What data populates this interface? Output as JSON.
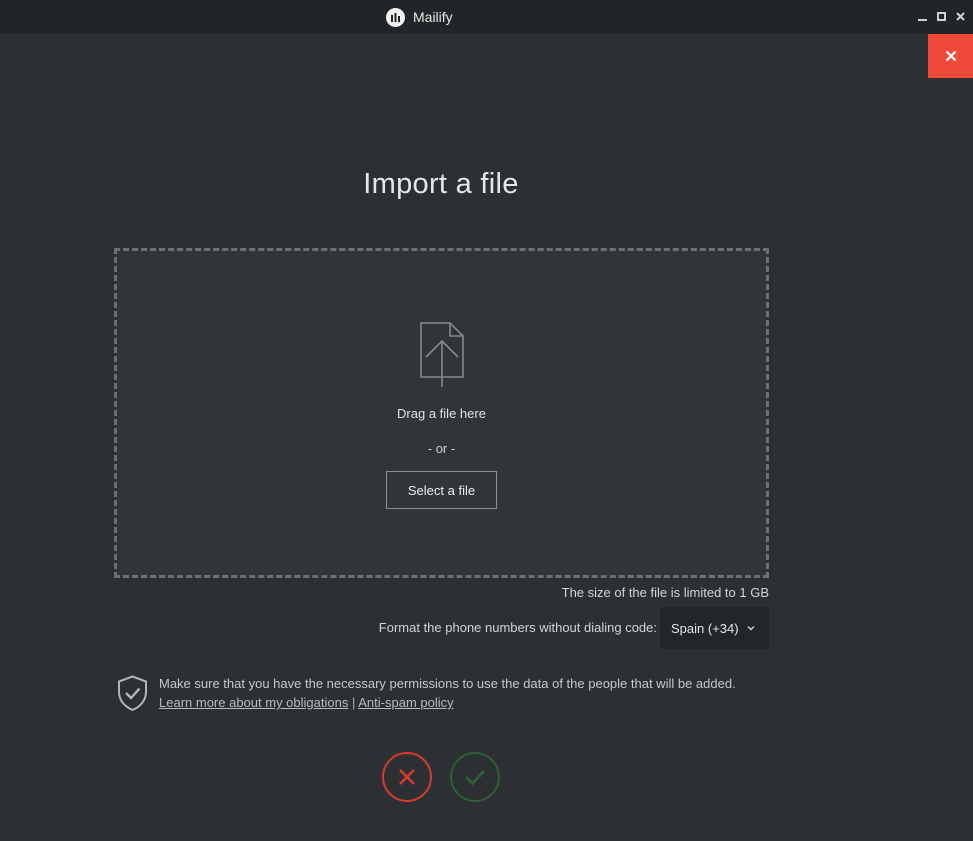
{
  "window": {
    "title": "Mailify",
    "close_color": "#f04a3a"
  },
  "main": {
    "title": "Import a file",
    "dropzone": {
      "icon": "file-upload-icon",
      "drag_text": "Drag a file here",
      "or_text": "- or -",
      "select_button": "Select a file"
    },
    "size_note": "The size of the file is limited to 1 GB",
    "phone_format": {
      "label": "Format the phone numbers without dialing code:",
      "selected": "Spain (+34)"
    },
    "permissions": {
      "icon": "shield-check-icon",
      "text": "Make sure that you have the necessary permissions to use the data of the people that will be added.",
      "link_obligations": "Learn more about my obligations",
      "separator": "|",
      "link_antispam": "Anti-spam policy"
    },
    "actions": {
      "cancel_icon": "close-icon",
      "cancel_color": "#d9392c",
      "confirm_icon": "check-icon",
      "confirm_color": "#2e5e35"
    }
  }
}
